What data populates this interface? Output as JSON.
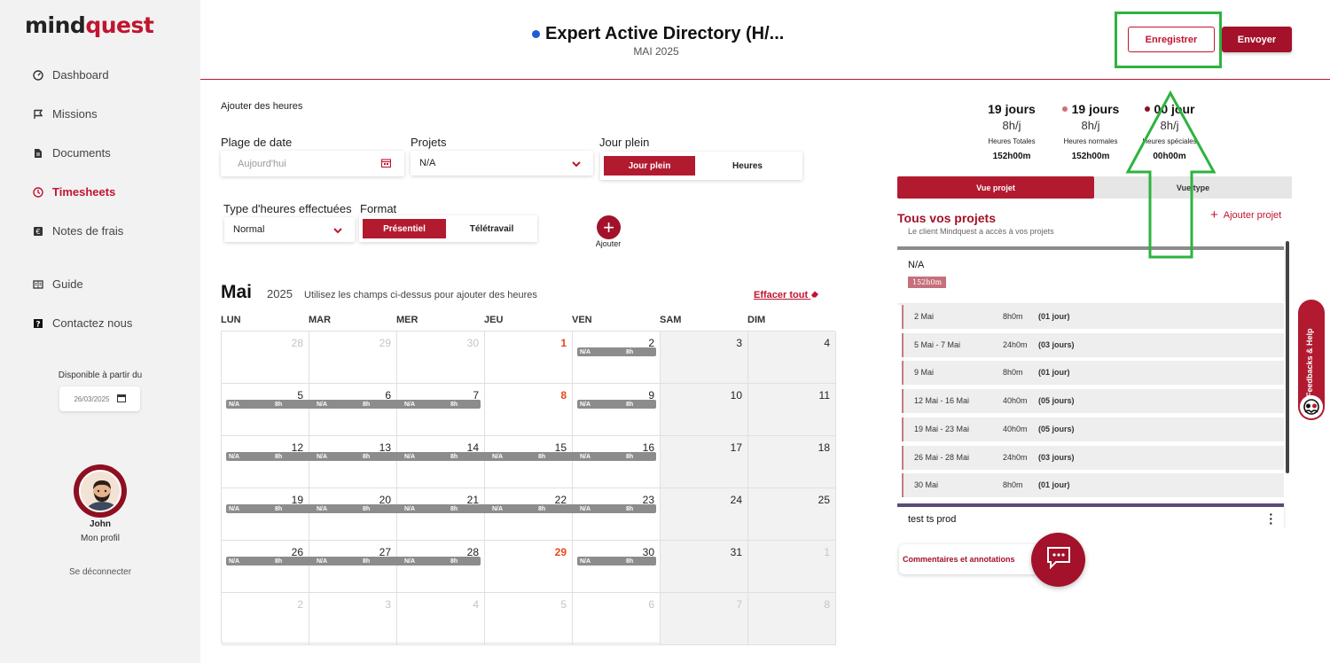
{
  "sidebar": {
    "logo_prefix": "mind",
    "logo_accent": "quest",
    "items": [
      {
        "label": "Dashboard",
        "icon": "gauge-icon"
      },
      {
        "label": "Missions",
        "icon": "flag-icon"
      },
      {
        "label": "Documents",
        "icon": "document-icon"
      },
      {
        "label": "Timesheets",
        "icon": "clock-icon"
      },
      {
        "label": "Notes de frais",
        "icon": "euro-receipt-icon"
      },
      {
        "label": "Guide",
        "icon": "book-icon"
      },
      {
        "label": "Contactez nous",
        "icon": "help-icon"
      }
    ],
    "available_label": "Disponible à partir du",
    "available_date": "26/03/2025",
    "user_name": "John",
    "profile_label": "Mon profil",
    "logout_label": "Se déconnecter"
  },
  "header": {
    "title": "Expert Active Directory (H/...",
    "subtitle": "MAI 2025",
    "save_label": "Enregistrer",
    "send_label": "Envoyer"
  },
  "form": {
    "section_label": "Ajouter des heures",
    "date_range_label": "Plage de date",
    "date_placeholder": "Aujourd'hui",
    "projects_label": "Projets",
    "projects_value": "N/A",
    "full_day_label": "Jour plein",
    "full_day_option": "Jour plein",
    "hours_option": "Heures",
    "hours_type_label": "Type d'heures effectuées",
    "hours_type_value": "Normal",
    "format_label": "Format",
    "onsite_option": "Présentiel",
    "remote_option": "Télétravail",
    "add_label": "Ajouter"
  },
  "calendar": {
    "month": "Mai",
    "year": "2025",
    "hint": "Utilisez les champs ci-dessus pour ajouter des heures",
    "clear_label": "Effacer tout",
    "weekdays": [
      "LUN",
      "MAR",
      "MER",
      "JEU",
      "VEN",
      "SAM",
      "DIM"
    ],
    "weeks": [
      [
        {
          "d": "28",
          "t": "muted"
        },
        {
          "d": "29",
          "t": "muted"
        },
        {
          "d": "30",
          "t": "muted"
        },
        {
          "d": "1",
          "t": "holiday"
        },
        {
          "d": "2",
          "t": ""
        },
        {
          "d": "3",
          "t": ""
        },
        {
          "d": "4",
          "t": ""
        }
      ],
      [
        {
          "d": "5",
          "t": ""
        },
        {
          "d": "6",
          "t": ""
        },
        {
          "d": "7",
          "t": ""
        },
        {
          "d": "8",
          "t": "holiday"
        },
        {
          "d": "9",
          "t": ""
        },
        {
          "d": "10",
          "t": ""
        },
        {
          "d": "11",
          "t": ""
        }
      ],
      [
        {
          "d": "12",
          "t": ""
        },
        {
          "d": "13",
          "t": ""
        },
        {
          "d": "14",
          "t": ""
        },
        {
          "d": "15",
          "t": ""
        },
        {
          "d": "16",
          "t": ""
        },
        {
          "d": "17",
          "t": ""
        },
        {
          "d": "18",
          "t": ""
        }
      ],
      [
        {
          "d": "19",
          "t": ""
        },
        {
          "d": "20",
          "t": ""
        },
        {
          "d": "21",
          "t": ""
        },
        {
          "d": "22",
          "t": ""
        },
        {
          "d": "23",
          "t": ""
        },
        {
          "d": "24",
          "t": ""
        },
        {
          "d": "25",
          "t": ""
        }
      ],
      [
        {
          "d": "26",
          "t": ""
        },
        {
          "d": "27",
          "t": ""
        },
        {
          "d": "28",
          "t": ""
        },
        {
          "d": "29",
          "t": "holiday"
        },
        {
          "d": "30",
          "t": ""
        },
        {
          "d": "31",
          "t": ""
        },
        {
          "d": "1",
          "t": "muted"
        }
      ],
      [
        {
          "d": "2",
          "t": "muted"
        },
        {
          "d": "3",
          "t": "muted"
        },
        {
          "d": "4",
          "t": "muted"
        },
        {
          "d": "5",
          "t": "muted"
        },
        {
          "d": "6",
          "t": "muted"
        },
        {
          "d": "7",
          "t": "muted"
        },
        {
          "d": "8",
          "t": "muted"
        }
      ]
    ],
    "entries": [
      {
        "week": 0,
        "from": 4,
        "to": 4,
        "project": "N/A",
        "hours": "8h"
      },
      {
        "week": 1,
        "from": 0,
        "to": 2,
        "project": "N/A",
        "hours": "8h"
      },
      {
        "week": 1,
        "from": 4,
        "to": 4,
        "project": "N/A",
        "hours": "8h"
      },
      {
        "week": 2,
        "from": 0,
        "to": 4,
        "project": "N/A",
        "hours": "8h"
      },
      {
        "week": 3,
        "from": 0,
        "to": 4,
        "project": "N/A",
        "hours": "8h"
      },
      {
        "week": 4,
        "from": 0,
        "to": 2,
        "project": "N/A",
        "hours": "8h"
      },
      {
        "week": 4,
        "from": 4,
        "to": 4,
        "project": "N/A",
        "hours": "8h"
      }
    ]
  },
  "stats": [
    {
      "days": "19 jours",
      "rate": "8h/j",
      "caption": "Heures Totales",
      "value": "152h00m",
      "dot": ""
    },
    {
      "days": "19 jours",
      "rate": "8h/j",
      "caption": "Heures normales",
      "value": "152h00m",
      "dot": "#d0707e"
    },
    {
      "days": "00 jour",
      "rate": "8h/j",
      "caption": "Heures spéciales",
      "value": "00h00m",
      "dot": "#8e1020"
    }
  ],
  "projects_panel": {
    "tab_project": "Vue projet",
    "tab_type": "Vue type",
    "title": "Tous vos projets",
    "subtitle": "Le client Mindquest a accès à vos projets",
    "add_label": "Ajouter projet",
    "project_name": "N/A",
    "project_total": "152h0m",
    "periods": [
      {
        "range": "2 Mai",
        "hours": "8h0m",
        "days": "(01 jour)"
      },
      {
        "range": "5 Mai - 7 Mai",
        "hours": "24h0m",
        "days": "(03 jours)"
      },
      {
        "range": "9 Mai",
        "hours": "8h0m",
        "days": "(01 jour)"
      },
      {
        "range": "12 Mai - 16 Mai",
        "hours": "40h0m",
        "days": "(05 jours)"
      },
      {
        "range": "19 Mai - 23 Mai",
        "hours": "40h0m",
        "days": "(05 jours)"
      },
      {
        "range": "26 Mai - 28 Mai",
        "hours": "24h0m",
        "days": "(03 jours)"
      },
      {
        "range": "30 Mai",
        "hours": "8h0m",
        "days": "(01 jour)"
      }
    ],
    "second_project": "test ts prod",
    "comments_label": "Commentaires et annotations"
  },
  "feedback_label": "Feedbacks & Help",
  "colors": {
    "brand": "#c0152f",
    "brand_dark": "#a3112a",
    "annotation": "#2db33f",
    "holiday": "#e4481b",
    "entry_bar": "#8c8c8c"
  }
}
